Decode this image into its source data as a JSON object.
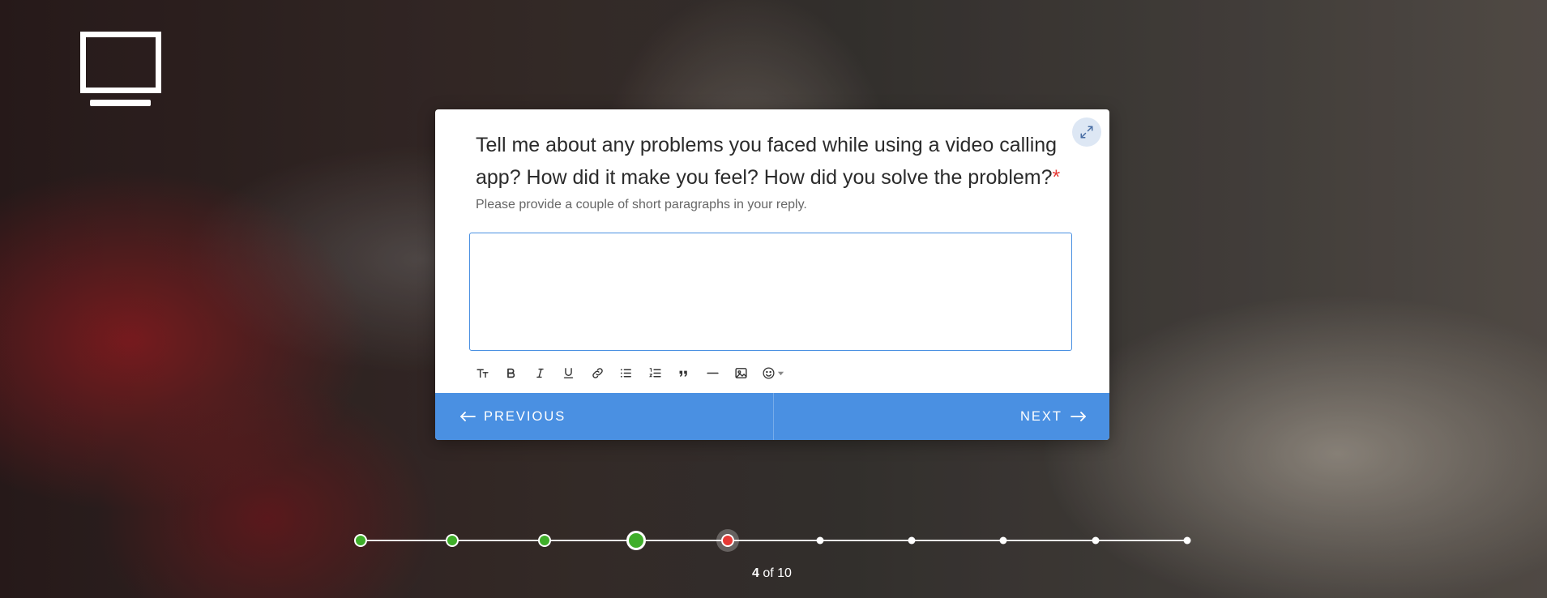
{
  "question": {
    "text": "Tell me about any problems you faced while using a video calling app? How did it make you feel? How did you solve the problem?",
    "required_mark": "*",
    "hint": "Please provide a couple of short paragraphs in your reply."
  },
  "answer": {
    "value": ""
  },
  "toolbar": {
    "items": [
      "text-size-icon",
      "bold-icon",
      "italic-icon",
      "underline-icon",
      "link-icon",
      "bullet-list-icon",
      "numbered-list-icon",
      "quote-icon",
      "horizontal-rule-icon",
      "image-icon",
      "emoji-icon"
    ]
  },
  "nav": {
    "previous_label": "PREVIOUS",
    "next_label": "NEXT"
  },
  "progress": {
    "current": "4",
    "separator": "of",
    "total": "10",
    "steps": [
      "done",
      "done",
      "done",
      "current",
      "error",
      "todo",
      "todo",
      "todo",
      "todo",
      "todo"
    ]
  },
  "colors": {
    "accent": "#4a90e2",
    "success": "#3fae2a",
    "error": "#e53935"
  }
}
